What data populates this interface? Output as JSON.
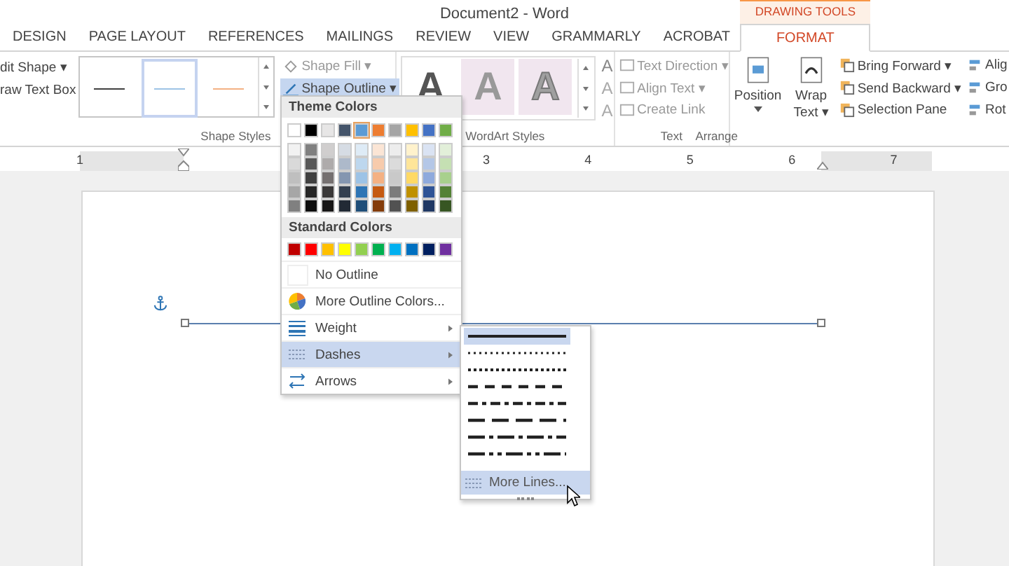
{
  "window": {
    "title": "Document2 - Word"
  },
  "tabs": [
    {
      "label": "DESIGN",
      "selected": false
    },
    {
      "label": "PAGE LAYOUT",
      "selected": false
    },
    {
      "label": "REFERENCES",
      "selected": false
    },
    {
      "label": "MAILINGS",
      "selected": false
    },
    {
      "label": "REVIEW",
      "selected": false
    },
    {
      "label": "VIEW",
      "selected": false
    },
    {
      "label": "GRAMMARLY",
      "selected": false
    },
    {
      "label": "ACROBAT",
      "selected": false
    },
    {
      "label": "FORMAT",
      "selected": true,
      "context": "DRAWING TOOLS"
    }
  ],
  "insert_shapes": {
    "items": [
      "dit Shape ▾",
      "raw Text Box"
    ]
  },
  "shape_styles": {
    "label": "Shape Styles",
    "styles": [
      {
        "color": "#404040",
        "selected": false
      },
      {
        "color": "#9dc3e6",
        "selected": true
      },
      {
        "color": "#f4b183",
        "selected": false
      }
    ],
    "fill": "Shape Fill ▾",
    "outline": "Shape Outline ▾"
  },
  "wordart": {
    "label": "WordArt Styles",
    "letters": [
      "A",
      "A",
      "A"
    ],
    "tools": [
      "A",
      "A",
      "A"
    ]
  },
  "text_group": {
    "label": "Text",
    "items": [
      "Text Direction ▾",
      "Align Text ▾",
      "Create Link"
    ]
  },
  "arrange": {
    "label": "Arrange",
    "position": "Position",
    "wrap_text": "Wrap Text ▾",
    "items": [
      "Bring Forward ▾",
      "Send Backward ▾",
      "Selection Pane"
    ],
    "cut_items": [
      "Alig",
      "Gro",
      "Rot"
    ]
  },
  "ruler": {
    "numbers": [
      "1",
      "3",
      "4",
      "5",
      "6",
      "7"
    ]
  },
  "outline_menu": {
    "theme_header": "Theme Colors",
    "theme_colors": [
      {
        "color": "#ffffff",
        "selected": false,
        "shades": [
          {
            "color": "#f2f2f2"
          },
          {
            "color": "#d9d9d9"
          },
          {
            "color": "#bfbfbf"
          },
          {
            "color": "#a6a6a6"
          },
          {
            "color": "#808080"
          }
        ]
      },
      {
        "color": "#000000",
        "selected": false,
        "shades": [
          {
            "color": "#808080"
          },
          {
            "color": "#595959"
          },
          {
            "color": "#404040"
          },
          {
            "color": "#262626"
          },
          {
            "color": "#0d0d0d"
          }
        ]
      },
      {
        "color": "#e7e6e6",
        "selected": false,
        "shades": [
          {
            "color": "#d0cece"
          },
          {
            "color": "#aeabab"
          },
          {
            "color": "#757070"
          },
          {
            "color": "#3a3838"
          },
          {
            "color": "#171616"
          }
        ]
      },
      {
        "color": "#44546a",
        "selected": false,
        "shades": [
          {
            "color": "#d6dce4"
          },
          {
            "color": "#adb9ca"
          },
          {
            "color": "#8496b0"
          },
          {
            "color": "#333f4f"
          },
          {
            "color": "#222a35"
          }
        ]
      },
      {
        "color": "#5b9bd5",
        "selected": true,
        "shades": [
          {
            "color": "#deebf6"
          },
          {
            "color": "#bdd7ee"
          },
          {
            "color": "#9dc3e6"
          },
          {
            "color": "#2e75b5"
          },
          {
            "color": "#1f4e79"
          }
        ]
      },
      {
        "color": "#ed7d31",
        "selected": false,
        "shades": [
          {
            "color": "#fbe5d5"
          },
          {
            "color": "#f7cbac"
          },
          {
            "color": "#f4b183"
          },
          {
            "color": "#c55a11"
          },
          {
            "color": "#843c0b"
          }
        ]
      },
      {
        "color": "#a5a5a5",
        "selected": false,
        "shades": [
          {
            "color": "#ededed"
          },
          {
            "color": "#dbdbdb"
          },
          {
            "color": "#c9c9c9"
          },
          {
            "color": "#7b7b7b"
          },
          {
            "color": "#525252"
          }
        ]
      },
      {
        "color": "#ffc000",
        "selected": false,
        "shades": [
          {
            "color": "#fff2cc"
          },
          {
            "color": "#fee599"
          },
          {
            "color": "#ffd965"
          },
          {
            "color": "#bf9000"
          },
          {
            "color": "#7f6000"
          }
        ]
      },
      {
        "color": "#4472c4",
        "selected": false,
        "shades": [
          {
            "color": "#dae3f3"
          },
          {
            "color": "#b4c7e7"
          },
          {
            "color": "#8faadc"
          },
          {
            "color": "#2f5496"
          },
          {
            "color": "#203864"
          }
        ]
      },
      {
        "color": "#70ad47",
        "selected": false,
        "shades": [
          {
            "color": "#e2efd9"
          },
          {
            "color": "#c5e0b3"
          },
          {
            "color": "#a8d08d"
          },
          {
            "color": "#538135"
          },
          {
            "color": "#375623"
          }
        ]
      }
    ],
    "standard_header": "Standard Colors",
    "standard_colors": [
      {
        "color": "#c00000"
      },
      {
        "color": "#ff0000"
      },
      {
        "color": "#ffc000"
      },
      {
        "color": "#ffff00"
      },
      {
        "color": "#92d050"
      },
      {
        "color": "#00b050"
      },
      {
        "color": "#00b0f0"
      },
      {
        "color": "#0070c0"
      },
      {
        "color": "#002060"
      },
      {
        "color": "#7030a0"
      }
    ],
    "items": [
      {
        "kind": "no-outline",
        "label": "No Outline",
        "selected": false,
        "submenu": false
      },
      {
        "kind": "more-colors",
        "label": "More Outline Colors...",
        "selected": false,
        "submenu": false
      },
      {
        "kind": "weight",
        "label": "Weight",
        "selected": false,
        "submenu": true
      },
      {
        "kind": "dashes",
        "label": "Dashes",
        "selected": true,
        "submenu": true
      },
      {
        "kind": "arrows",
        "label": "Arrows",
        "selected": false,
        "submenu": true
      }
    ]
  },
  "dashes_menu": {
    "lines": [
      {
        "kind": "solid",
        "selected": true
      },
      {
        "kind": "round-dot",
        "selected": false
      },
      {
        "kind": "square-dot",
        "selected": false
      },
      {
        "kind": "dash",
        "selected": false
      },
      {
        "kind": "dash-dot",
        "selected": false
      },
      {
        "kind": "long-dash",
        "selected": false
      },
      {
        "kind": "long-dash-dot",
        "selected": false
      },
      {
        "kind": "long-dash-dot-dot",
        "selected": false
      }
    ],
    "more": {
      "label": "More Lines...",
      "selected": true
    }
  }
}
